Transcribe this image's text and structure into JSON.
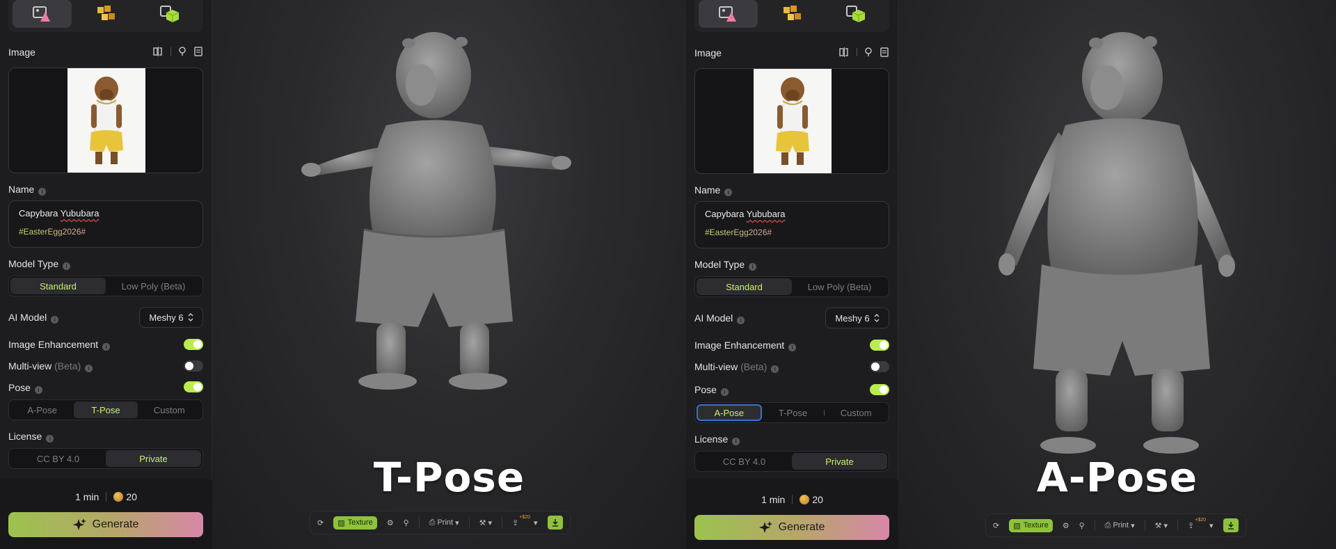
{
  "panels": [
    {
      "image_label": "Image",
      "name_label": "Name",
      "name_line1_word1": "Capybara",
      "name_line1_word2": "Yububara",
      "name_line2": "#EasterEgg2026#",
      "model_type_label": "Model Type",
      "model_types": [
        "Standard",
        "Low Poly (Beta)"
      ],
      "ai_model_label": "AI Model",
      "ai_model_value": "Meshy 6",
      "image_enhancement_label": "Image Enhancement",
      "multiview_label": "Multi-view",
      "multiview_beta": "(Beta)",
      "pose_label": "Pose",
      "poses": [
        "A-Pose",
        "T-Pose",
        "Custom"
      ],
      "selected_pose": "T-Pose",
      "license_label": "License",
      "licenses": [
        "CC BY 4.0",
        "Private"
      ],
      "time": "1 min",
      "credits": "20",
      "generate_label": "Generate"
    },
    {
      "image_label": "Image",
      "name_label": "Name",
      "name_line1_word1": "Capybara",
      "name_line1_word2": "Yububara",
      "name_line2": "#EasterEgg2026#",
      "model_type_label": "Model Type",
      "model_types": [
        "Standard",
        "Low Poly (Beta)"
      ],
      "ai_model_label": "AI Model",
      "ai_model_value": "Meshy 6",
      "image_enhancement_label": "Image Enhancement",
      "multiview_label": "Multi-view",
      "multiview_beta": "(Beta)",
      "pose_label": "Pose",
      "poses": [
        "A-Pose",
        "T-Pose",
        "Custom"
      ],
      "selected_pose": "A-Pose",
      "license_label": "License",
      "licenses": [
        "CC BY 4.0",
        "Private"
      ],
      "time": "1 min",
      "credits": "20",
      "generate_label": "Generate"
    }
  ],
  "viewports": [
    {
      "caption": "T-Pose"
    },
    {
      "caption": "A-Pose"
    }
  ],
  "toolbar": {
    "texture_label": "Texture",
    "print_label": "Print",
    "badge": "+$20"
  },
  "icons": [
    "image-to-3d-icon",
    "multi-cube-icon",
    "texture-cube-icon",
    "flip-icon",
    "bulb-icon",
    "book-icon",
    "sparkle-icon",
    "refresh-icon",
    "download-icon"
  ],
  "colors": {
    "accent_green": "#b9ec4e",
    "selected_text": "#c9f26b",
    "generate_start": "#9cc24e",
    "generate_end": "#d887a9",
    "focus_ring": "#3d6fd8"
  }
}
